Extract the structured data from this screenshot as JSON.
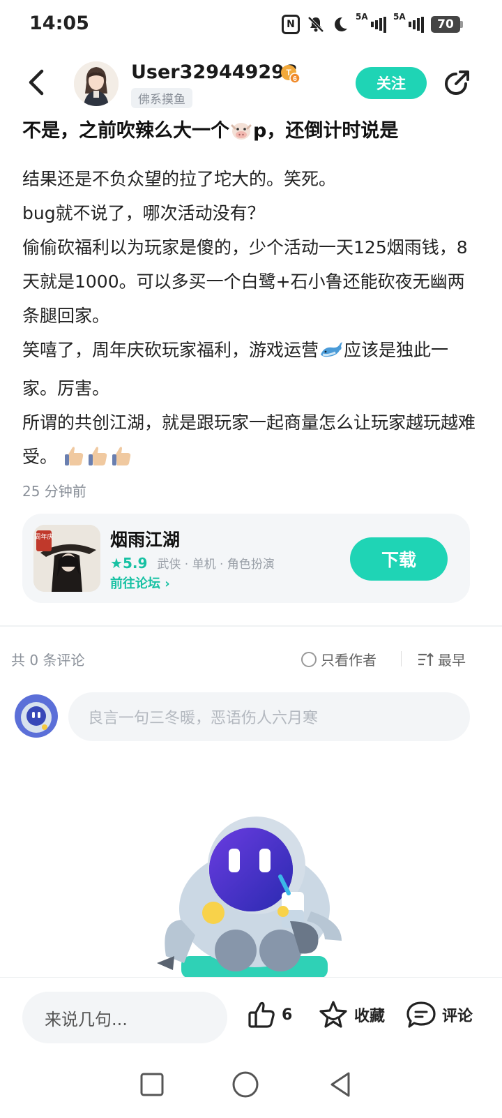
{
  "status_bar": {
    "time": "14:05",
    "nfc_icon": "N",
    "sim1_label": "5A",
    "sim2_label": "5A",
    "battery": "70"
  },
  "header": {
    "username": "User329449298",
    "level_badge": "6",
    "user_tag": "佛系摸鱼",
    "follow_label": "关注"
  },
  "post": {
    "title_before": "不是，之前吹辣么大一个",
    "title_after": "p，还倒计时说是",
    "paragraphs": {
      "p1": "结果还是不负众望的拉了坨大的。笑死。",
      "p2": "bug就不说了，哪次活动没有？",
      "p3": "偷偷砍福利以为玩家是傻的，少个活动一天125烟雨钱，8天就是1000。可以多买一个白鹭+石小鲁还能砍夜无幽两条腿回家。",
      "p4_before": "笑嘻了，周年庆砍玩家福利，游戏运营",
      "p4_after": "应该是独此一家。厉害。",
      "p5": "所谓的共创江湖，就是跟玩家一起商量怎么让玩家越玩越难受。"
    },
    "time": "25 分钟前"
  },
  "game_card": {
    "cover_text": "周年庆",
    "name": "烟雨江湖",
    "rating": "5.9",
    "tags": "武侠 · 单机 · 角色扮演",
    "forum_link": "前往论坛",
    "download_label": "下载"
  },
  "comments": {
    "count_label": "共 0 条评论",
    "author_only_label": "只看作者",
    "sort_label": "最早",
    "input_placeholder": "良言一句三冬暖，恶语伤人六月寒"
  },
  "bottom_bar": {
    "quick_input": "来说几句...",
    "like_count": "6",
    "favorite_label": "收藏",
    "comment_label": "评论"
  },
  "colors": {
    "accent": "#1fd4b5",
    "text_primary": "#1a1a1a",
    "text_secondary": "#8a9099"
  }
}
